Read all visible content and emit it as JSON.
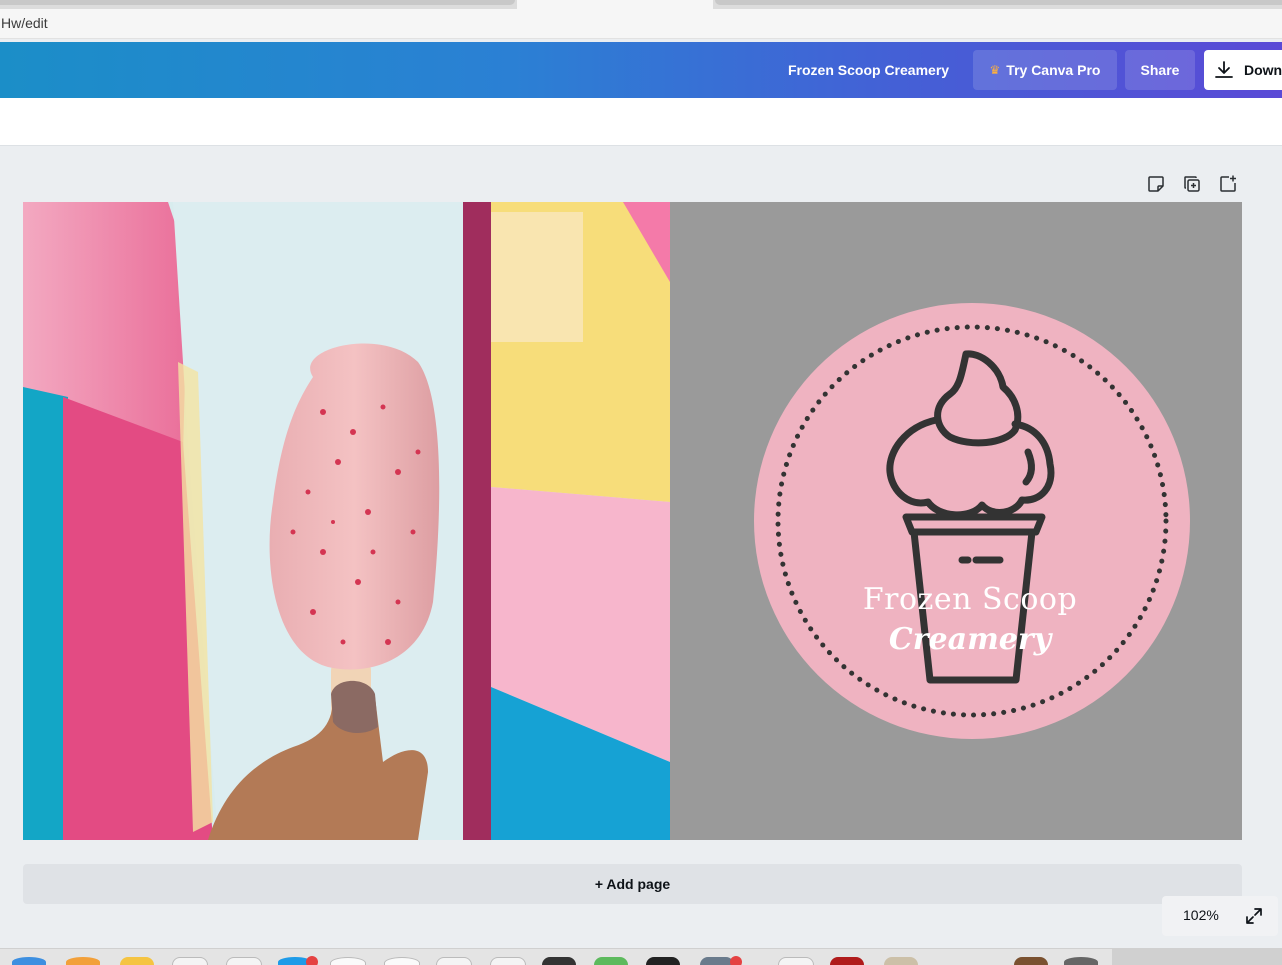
{
  "browser": {
    "url_fragment": "Hw/edit"
  },
  "header": {
    "document_title": "Frozen Scoop Creamery",
    "try_pro_label": "Try Canva Pro",
    "share_label": "Share",
    "download_label": "Down"
  },
  "design": {
    "logo_line_1": "Frozen Scoop",
    "logo_line_2": "Creamery",
    "panel_color": "#9a9a9a",
    "badge_color": "#efb3c1",
    "icon_stroke_color": "#333333"
  },
  "canvas": {
    "add_page_label": "+ Add page",
    "zoom_label": "102%"
  },
  "icons": {
    "page_notes": "sticky-note-icon",
    "duplicate_page": "duplicate-page-icon",
    "add_page": "add-page-icon",
    "download": "download-icon",
    "crown": "crown-icon",
    "fullscreen": "expand-icon"
  }
}
